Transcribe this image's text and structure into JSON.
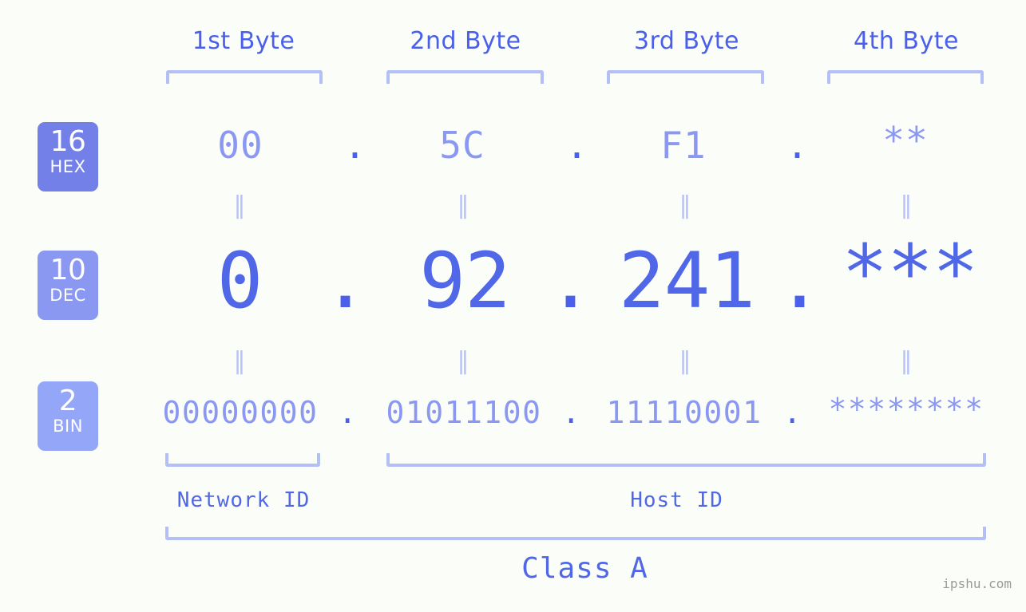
{
  "page": {
    "background": "#fbfdf8",
    "accent": "#5068e8",
    "accent_light": "#8b98f2",
    "bracket_color": "#b4c0f5",
    "watermark": "ipshu.com"
  },
  "byte_headers": [
    {
      "label": "1st Byte"
    },
    {
      "label": "2nd Byte"
    },
    {
      "label": "3rd Byte"
    },
    {
      "label": "4th Byte"
    }
  ],
  "bases": [
    {
      "num": "16",
      "name": "HEX",
      "color": "#7280e8"
    },
    {
      "num": "10",
      "name": "DEC",
      "color": "#8b98f2"
    },
    {
      "num": "2",
      "name": "BIN",
      "color": "#93a6f7"
    }
  ],
  "rows": {
    "hex": {
      "base_num": "16",
      "base_name": "HEX",
      "values": [
        "00",
        "5C",
        "F1",
        "**"
      ],
      "separator": "."
    },
    "dec": {
      "base_num": "10",
      "base_name": "DEC",
      "values": [
        "0",
        "92",
        "241",
        "***"
      ],
      "separator": "."
    },
    "bin": {
      "base_num": "2",
      "base_name": "BIN",
      "values": [
        "00000000",
        "01011100",
        "11110001",
        "********"
      ],
      "separator": "."
    }
  },
  "equals_glyph": "‖",
  "id_labels": {
    "network": "Network ID",
    "host": "Host ID"
  },
  "class_label": "Class A"
}
